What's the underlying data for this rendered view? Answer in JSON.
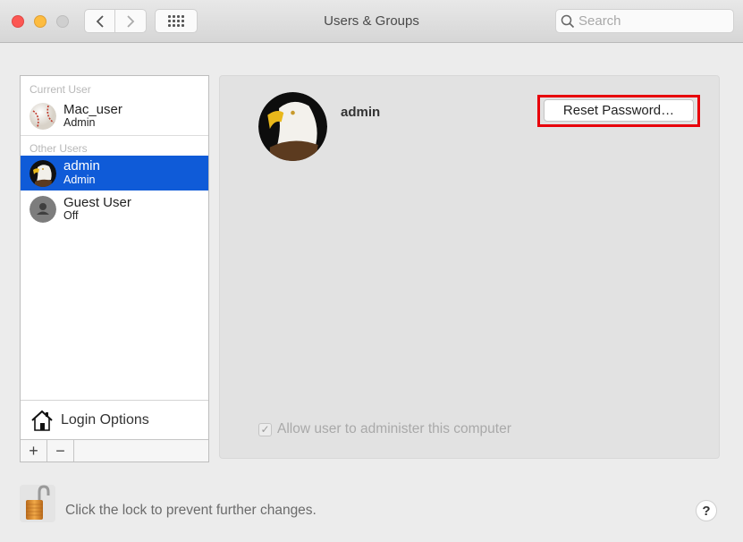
{
  "window": {
    "title": "Users & Groups",
    "search_placeholder": "Search",
    "back_icon": "chevron-left",
    "forward_icon": "chevron-right",
    "grid_icon": "show-all-grid"
  },
  "sidebar": {
    "current_user_label": "Current User",
    "other_users_label": "Other Users",
    "current_user": {
      "name": "Mac_user",
      "role": "Admin",
      "avatar": "baseball"
    },
    "other_users": [
      {
        "name": "admin",
        "role": "Admin",
        "avatar": "eagle",
        "selected": true
      },
      {
        "name": "Guest User",
        "role": "Off",
        "avatar": "generic-person",
        "selected": false
      }
    ],
    "login_options_label": "Login Options",
    "add_label": "+",
    "remove_label": "−"
  },
  "detail": {
    "username": "admin",
    "reset_password_label": "Reset Password…",
    "allow_admin_label": "Allow user to administer this computer",
    "allow_admin_checked": true,
    "allow_admin_enabled": false
  },
  "footer": {
    "lock_text": "Click the lock to prevent further changes.",
    "lock_state": "unlocked",
    "help_label": "?"
  },
  "colors": {
    "selection": "#0f5bd8",
    "highlight_box": "#e8000b"
  }
}
